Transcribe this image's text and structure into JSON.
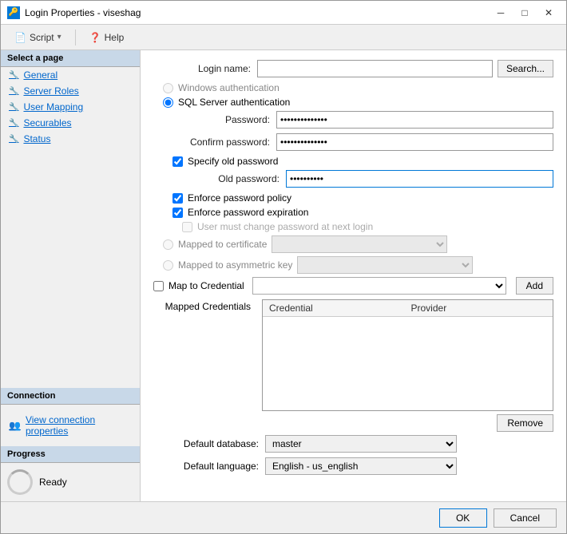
{
  "window": {
    "title": "Login Properties - viseshag",
    "icon": "🔑"
  },
  "titlebar": {
    "minimize": "─",
    "maximize": "□",
    "close": "✕"
  },
  "toolbar": {
    "script_label": "Script",
    "help_label": "Help",
    "dropdown_arrow": "▾"
  },
  "sidebar": {
    "select_page_header": "Select a page",
    "items": [
      {
        "label": "General",
        "icon": "🔧"
      },
      {
        "label": "Server Roles",
        "icon": "🔧"
      },
      {
        "label": "User Mapping",
        "icon": "🔧"
      },
      {
        "label": "Securables",
        "icon": "🔧"
      },
      {
        "label": "Status",
        "icon": "🔧"
      }
    ],
    "connection_header": "Connection",
    "connection_link": "View connection properties",
    "progress_header": "Progress",
    "progress_status": "Ready"
  },
  "form": {
    "login_name_label": "Login name:",
    "search_btn": "Search...",
    "windows_auth_label": "Windows authentication",
    "sql_auth_label": "SQL Server authentication",
    "password_label": "Password:",
    "password_value": "••••••••••••••",
    "confirm_password_label": "Confirm password:",
    "confirm_password_value": "••••••••••••••",
    "specify_old_password_label": "Specify old password",
    "old_password_label": "Old password:",
    "old_password_value": "••••••••••",
    "enforce_policy_label": "Enforce password policy",
    "enforce_expiration_label": "Enforce password expiration",
    "user_must_change_label": "User must change password at next login",
    "mapped_to_cert_label": "Mapped to certificate",
    "mapped_to_asym_label": "Mapped to asymmetric key",
    "map_to_credential_label": "Map to Credential",
    "add_btn": "Add",
    "mapped_credentials_label": "Mapped Credentials",
    "credential_col": "Credential",
    "provider_col": "Provider",
    "remove_btn": "Remove",
    "default_db_label": "Default database:",
    "default_db_value": "master",
    "default_lang_label": "Default language:",
    "default_lang_value": "English - us_english"
  },
  "bottom": {
    "ok_label": "OK",
    "cancel_label": "Cancel"
  }
}
